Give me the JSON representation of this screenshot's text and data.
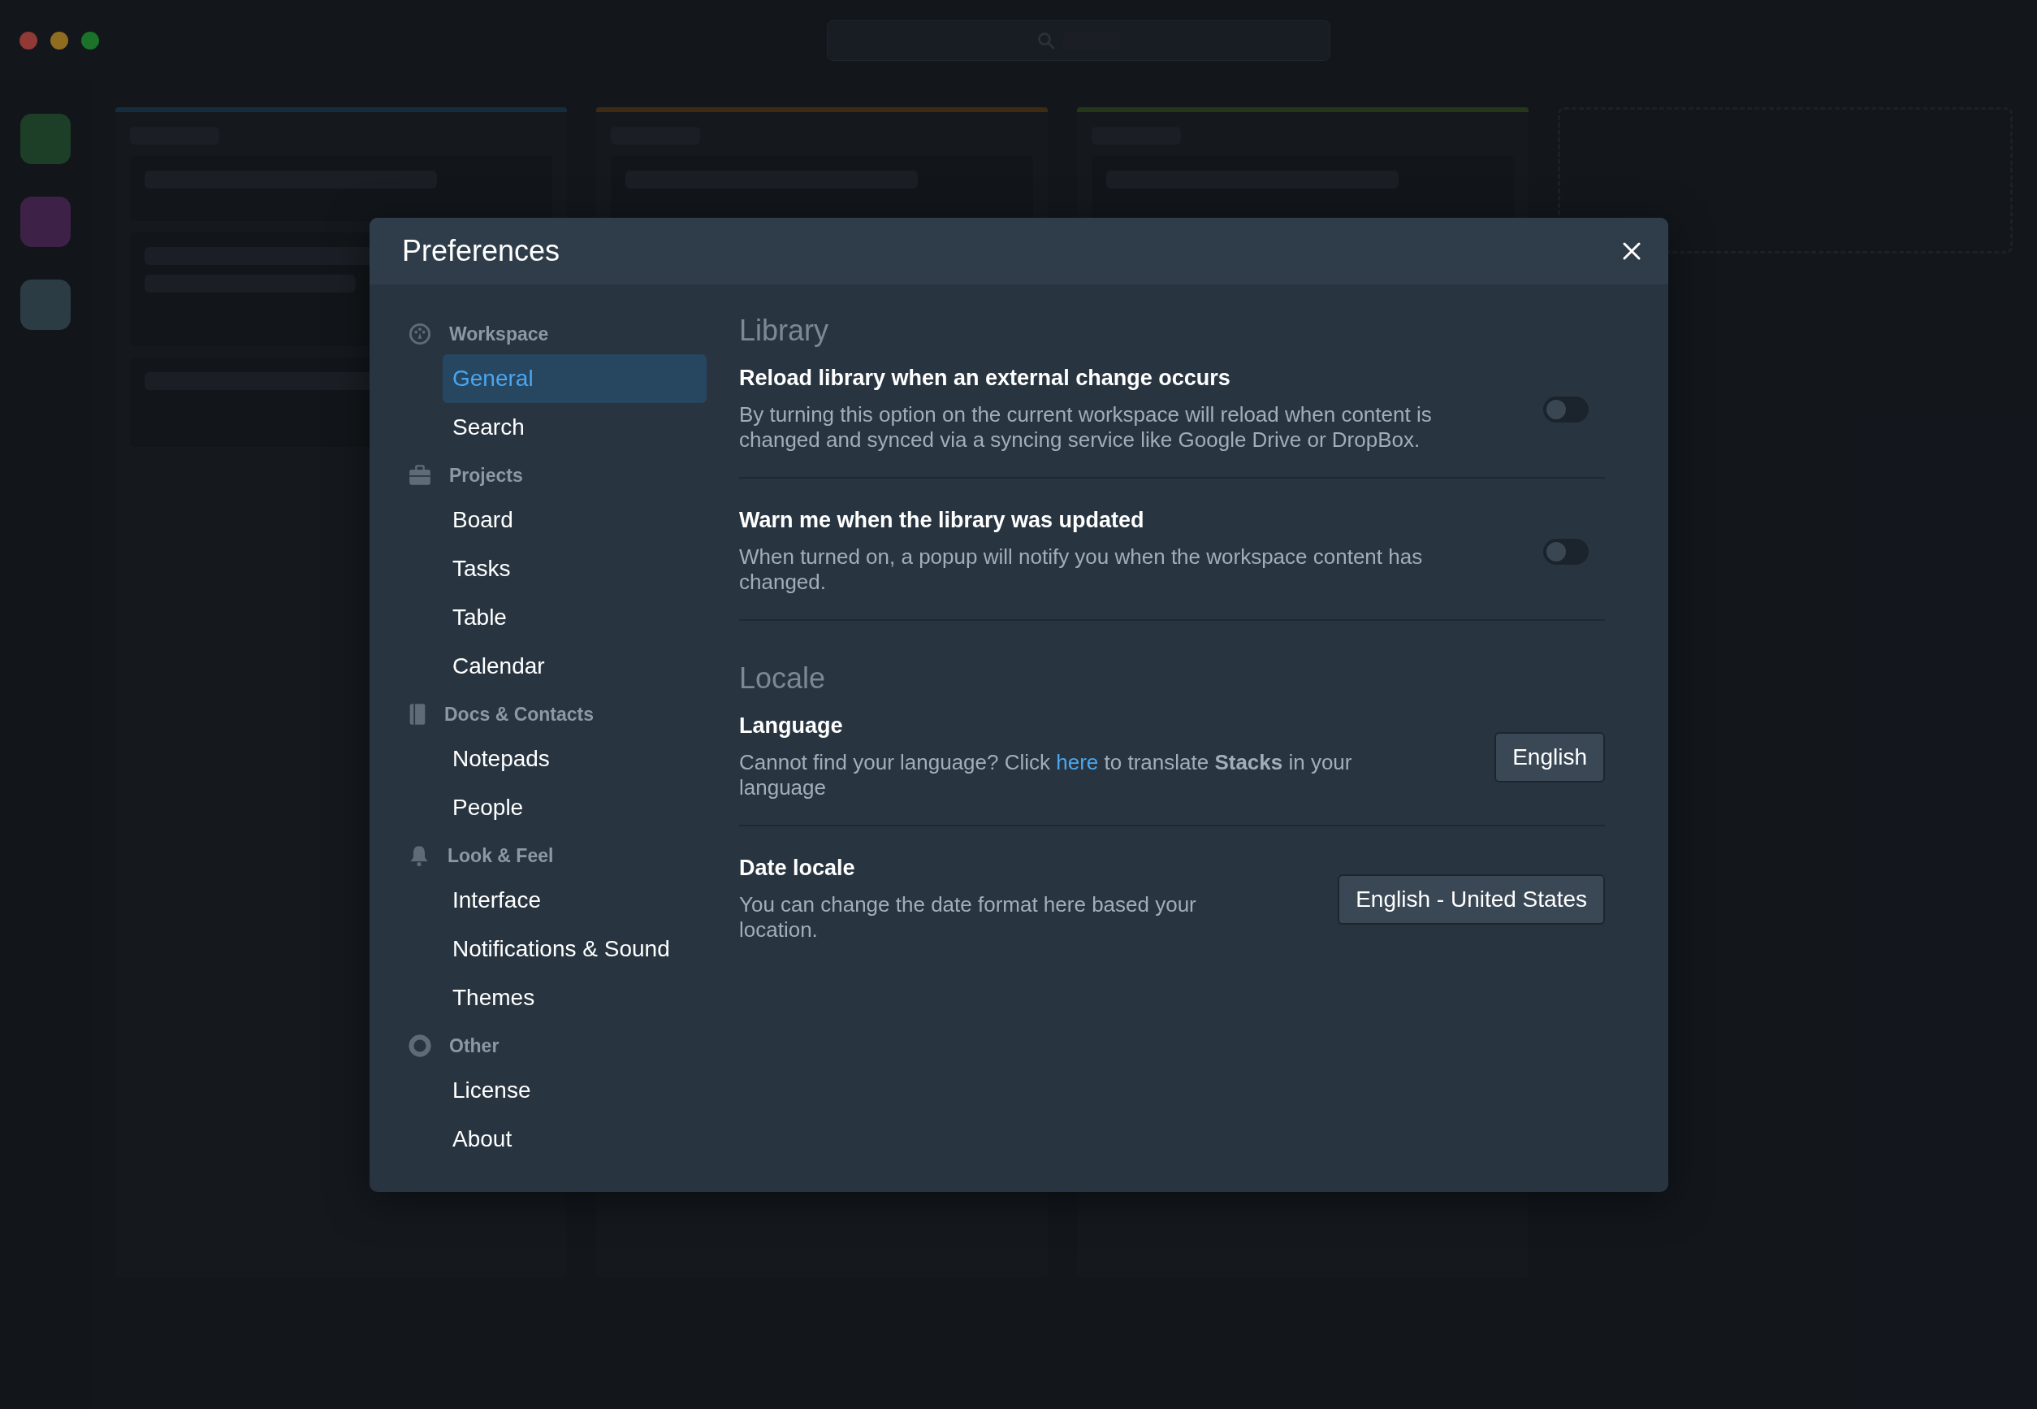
{
  "preferences": {
    "title": "Preferences",
    "nav": [
      {
        "heading": "Workspace",
        "items": [
          {
            "label": "General",
            "selected": true
          },
          {
            "label": "Search",
            "selected": false
          }
        ]
      },
      {
        "heading": "Projects",
        "items": [
          {
            "label": "Board",
            "selected": false
          },
          {
            "label": "Tasks",
            "selected": false
          },
          {
            "label": "Table",
            "selected": false
          },
          {
            "label": "Calendar",
            "selected": false
          }
        ]
      },
      {
        "heading": "Docs & Contacts",
        "items": [
          {
            "label": "Notepads",
            "selected": false
          },
          {
            "label": "People",
            "selected": false
          }
        ]
      },
      {
        "heading": "Look & Feel",
        "items": [
          {
            "label": "Interface",
            "selected": false
          },
          {
            "label": "Notifications & Sound",
            "selected": false
          },
          {
            "label": "Themes",
            "selected": false
          }
        ]
      },
      {
        "heading": "Other",
        "items": [
          {
            "label": "License",
            "selected": false
          },
          {
            "label": "About",
            "selected": false
          }
        ]
      }
    ],
    "sections": [
      {
        "title": "Library",
        "settings": [
          {
            "kind": "toggle",
            "title": "Reload library when an external change occurs",
            "description": "By turning this option on the current workspace will reload when content is changed and synced via a syncing service like Google Drive or DropBox.",
            "on": false
          },
          {
            "kind": "toggle",
            "title": "Warn me when the library was updated",
            "description": "When turned on, a popup will notify you when the workspace content has changed.",
            "on": false
          }
        ]
      },
      {
        "title": "Locale",
        "settings": [
          {
            "kind": "select",
            "title": "Language",
            "description": "Cannot find your language? Click ",
            "link": "here",
            "description_after": " to translate **Stacks** in your language",
            "value": "English"
          },
          {
            "kind": "select",
            "title": "Date locale",
            "description": "You can change the date format here based your location.",
            "value": "English - United States"
          }
        ]
      }
    ]
  }
}
